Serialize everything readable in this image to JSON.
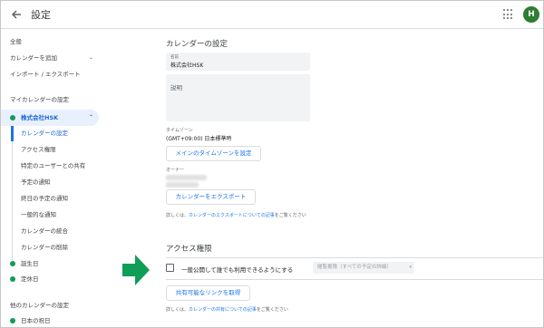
{
  "header": {
    "title": "設定",
    "avatar_letter": "H",
    "avatar_color": "#2e7d32"
  },
  "sidebar": {
    "general": "全般",
    "add_calendar": "カレンダーを追加",
    "import_export": "インポート / エクスポート",
    "my_calendars_heading": "マイカレンダーの設定",
    "active_calendar": {
      "label": "株式会社HSK",
      "color": "#0f9d58"
    },
    "sub_items": [
      "カレンダーの設定",
      "アクセス権限",
      "特定のユーザーとの共有",
      "予定の通知",
      "終日の予定の通知",
      "一般的な通知",
      "カレンダーの統合",
      "カレンダーの削除"
    ],
    "other_calendars": [
      {
        "label": "誕生日",
        "color": "#0f9d58"
      },
      {
        "label": "定休日",
        "color": "#0f9d58"
      }
    ],
    "others_heading": "他のカレンダーの設定",
    "japan_holidays": {
      "label": "日本の祝日",
      "color": "#0f9d58"
    }
  },
  "main": {
    "calendar_settings_title": "カレンダーの設定",
    "name_label": "名前",
    "name_value": "株式会社HSK",
    "description_placeholder": "説明",
    "timezone_label": "タイムゾーン",
    "timezone_value": "(GMT+09:00) 日本標準時",
    "main_timezone_button": "メインのタイムゾーンを設定",
    "owner_label": "オーナー",
    "export_button": "カレンダーをエクスポート",
    "export_help_prefix": "詳しくは、",
    "export_help_link": "カレンダーのエクスポートについての記事",
    "export_help_suffix": "をご覧ください",
    "access_title": "アクセス権限",
    "public_checkbox_label": "一般公開して誰でも利用できるようにする",
    "public_checked": false,
    "visibility_select": "閲覧権限（すべての予定の詳細）",
    "share_link_button": "共有可能なリンクを取得",
    "share_help_prefix": "詳しくは、",
    "share_help_link": "カレンダーの共有についての記事",
    "share_help_suffix": "をご覧ください"
  },
  "annotation": {
    "arrow_color": "#0f9d58"
  }
}
